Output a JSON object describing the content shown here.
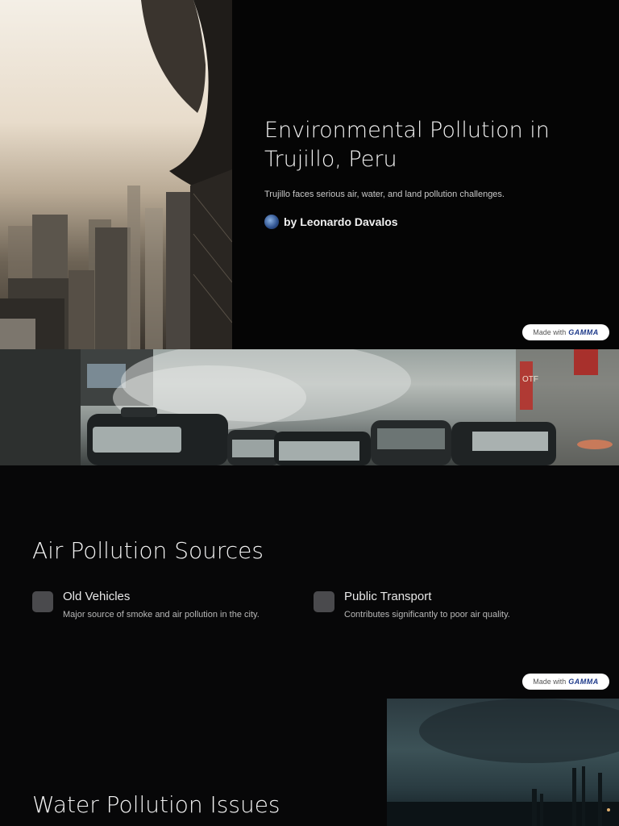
{
  "hero": {
    "title": "Environmental Pollution in Trujillo, Peru",
    "subtitle": "Trujillo faces serious air, water, and land pollution challenges.",
    "author": "by Leonardo Davalos"
  },
  "badge": {
    "made_with": "Made with",
    "brand": "GAMMA"
  },
  "air": {
    "title": "Air Pollution Sources",
    "items": [
      {
        "title": "Old Vehicles",
        "desc": "Major source of smoke and air pollution in the city."
      },
      {
        "title": "Public Transport",
        "desc": "Contributes significantly to poor air quality."
      }
    ]
  },
  "water": {
    "title": "Water Pollution Issues"
  },
  "banner": {
    "sign_text": "OTF"
  }
}
